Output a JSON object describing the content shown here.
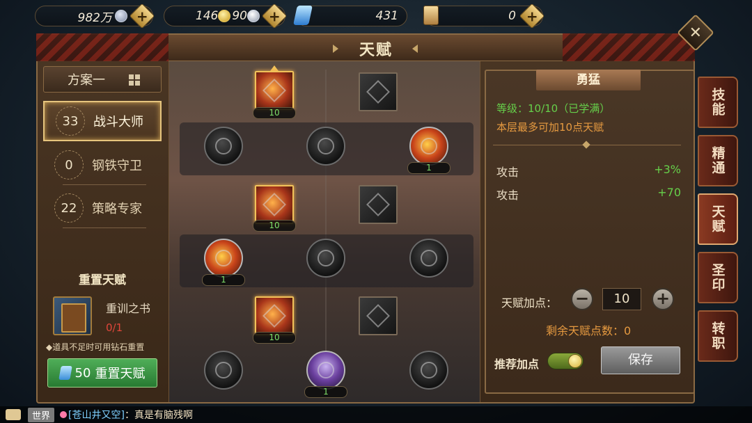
{
  "resources": {
    "silver": "982万",
    "gold_a": "146",
    "gold_b": "90",
    "diamond": "431",
    "scroll": "0",
    "plus": "+"
  },
  "close_label": "✕",
  "title": "天赋",
  "plan_label": "方案一",
  "specs": [
    {
      "count": "33",
      "name": "战斗大师"
    },
    {
      "count": "0",
      "name": "钢铁守卫"
    },
    {
      "count": "22",
      "name": "策略专家"
    }
  ],
  "reset": {
    "title": "重置天赋",
    "item_name": "重训之书",
    "item_count": "0/1",
    "note": "◆道具不足时可用钻石重置",
    "button_cost": "50",
    "button_label": "重置天赋"
  },
  "tree_levels": {
    "r1c1": "10",
    "r2c3": "1",
    "r3c1": "10",
    "r4c1": "1",
    "r5c1": "10",
    "r6c2": "1"
  },
  "detail": {
    "title": "勇猛",
    "level": "等级：10/10（已学满）",
    "layer_note": "本层最多可加10点天赋",
    "stats": [
      {
        "name": "攻击",
        "bonus": "+3%"
      },
      {
        "name": "攻击",
        "bonus": "+70"
      }
    ],
    "points_label": "天赋加点：",
    "points_value": "10",
    "minus": "−",
    "plus": "+",
    "remaining": "剩余天赋点数：0",
    "recommend_label": "推荐加点",
    "recommend_on": true,
    "save_label": "保存"
  },
  "side_tabs": [
    {
      "label": "技能",
      "active": false
    },
    {
      "label": "精通",
      "active": false
    },
    {
      "label": "天赋",
      "active": true
    },
    {
      "label": "圣印",
      "active": false
    },
    {
      "label": "转职",
      "active": false
    }
  ],
  "chat": {
    "channel": "世界",
    "sender": "[苍山井又空]",
    "message": "：真是有脑残啊"
  }
}
